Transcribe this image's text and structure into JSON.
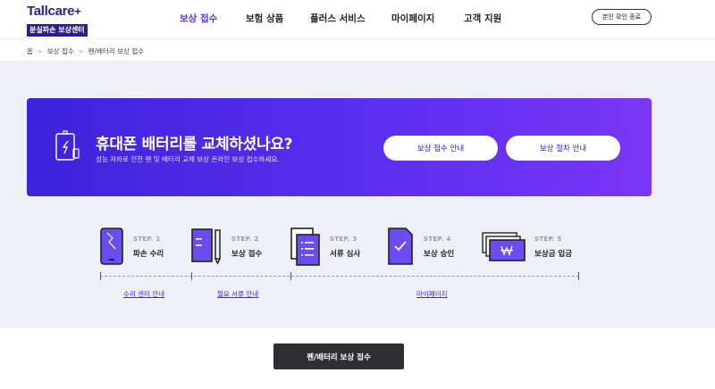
{
  "header": {
    "logo_text": "Tallcare",
    "logo_plus": "+",
    "logo_sub": "분실파손 보상센터",
    "verify_button": "본인 확인 종료"
  },
  "nav": [
    {
      "label": "보상 접수",
      "active": true
    },
    {
      "label": "보험 상품",
      "active": false
    },
    {
      "label": "플러스 서비스",
      "active": false
    },
    {
      "label": "마이페이지",
      "active": false
    },
    {
      "label": "고객 지원",
      "active": false
    }
  ],
  "breadcrumb": [
    "홈",
    "보상 접수",
    "펜/배터리 보상 접수"
  ],
  "banner": {
    "title": "휴대폰 배터리를 교체하셨나요?",
    "subtitle": "성능 저하로 인한 펜 및 배터리 교체 보상 온라인 보상 접수하세요.",
    "btn_guide": "보상 접수 안내",
    "btn_process": "보상 절차 안내"
  },
  "steps": [
    {
      "label": "STEP. 1",
      "name": "파손 수리",
      "icon": "broken-phone-icon"
    },
    {
      "label": "STEP. 2",
      "name": "보상 접수",
      "icon": "document-pen-icon"
    },
    {
      "label": "STEP. 3",
      "name": "서류 심사",
      "icon": "documents-stack-icon"
    },
    {
      "label": "STEP. 4",
      "name": "보상 승인",
      "icon": "approval-check-icon"
    },
    {
      "label": "STEP. 5",
      "name": "보상금 입금",
      "icon": "money-won-icon"
    }
  ],
  "links": {
    "repair_center": "수리 센터 안내",
    "required_docs": "필요 서류 안내",
    "mypage": "마이페이지"
  },
  "submit_button": "펜/배터리 보상 접수",
  "colors": {
    "brand_navy": "#2a1f8f",
    "accent": "#5a32e6",
    "banner_start": "#3d23d9",
    "banner_end": "#7a36f5",
    "section_bg": "#eef0f6",
    "submit_bg": "#2e2e33"
  }
}
